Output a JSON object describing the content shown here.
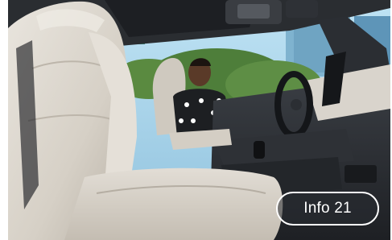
{
  "photo": {
    "subject": "car-interior-photo",
    "colors": {
      "seat": "#d8d2c8",
      "dash": "#2a2d31",
      "sky": "#a9d3ea",
      "foliage": "#4e7e3a"
    }
  },
  "info_button": {
    "label": "Info 21"
  }
}
